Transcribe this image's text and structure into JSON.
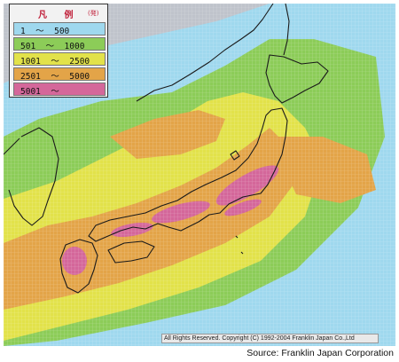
{
  "legend": {
    "title": "凡 例",
    "unit": "(発)",
    "items": [
      {
        "label": "1  ～  500",
        "color": "#9fd8ee"
      },
      {
        "label": "501  ～  1000",
        "color": "#8ccc58"
      },
      {
        "label": "1001  ～  2500",
        "color": "#e2e24a"
      },
      {
        "label": "2501  ～  5000",
        "color": "#e3a448"
      },
      {
        "label": "5001  ～",
        "color": "#d4679a"
      }
    ]
  },
  "map": {
    "copyright": "All Rights Reserved. Copyright (C) 1992-2004 Franklin Japan Co.,Ltd",
    "colors": {
      "outside": "#bfc3cb",
      "class1": "#9fd8ee",
      "class2": "#8ccc58",
      "class3": "#e2e24a",
      "class4": "#e3a448",
      "class5": "#d4679a",
      "coast": "#1a1a1a"
    }
  },
  "footer": {
    "source": "Source: Franklin Japan Corporation"
  }
}
